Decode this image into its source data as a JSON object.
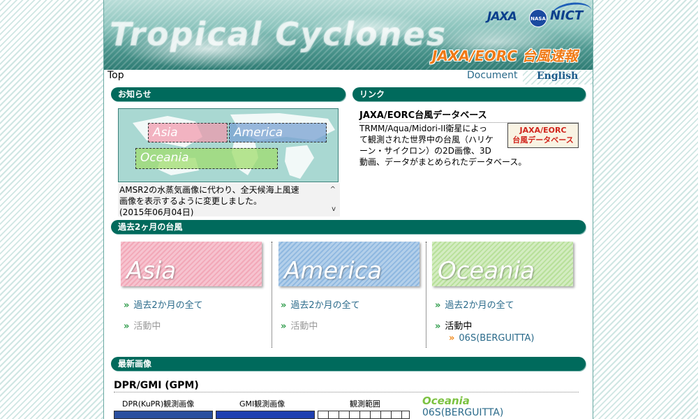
{
  "banner": {
    "title": "Tropical Cyclones",
    "subtitle": "JAXA/EORC 台風速報",
    "logos": {
      "jaxa": "JAXA",
      "nasa": "NASA",
      "nict": "NICT"
    }
  },
  "nav": {
    "top": "Top",
    "document": "Document",
    "english": "English"
  },
  "news": {
    "header": "お知らせ",
    "map_regions": {
      "asia": "Asia",
      "america": "America",
      "oceania": "Oceania"
    },
    "text_line1": "AMSR2の水蒸気画像に代わり、全天候海上風速",
    "text_line2": "画像を表示するように変更しました。",
    "text_line3": "(2015年06月04日)",
    "scroll_up": "^",
    "scroll_down": "v"
  },
  "links": {
    "header": "リンク",
    "title": "JAXA/EORC台風データベース",
    "description": "TRMM/Aqua/Midori-II衛星によって観測された世界中の台風（ハリケーン・サイクロン）の2D画像、3D動画、データがまとめられたデータベース。",
    "badge_line1": "JAXA/EORC",
    "badge_line2": "台風データベース"
  },
  "recent": {
    "header": "過去2ヶ月の台風",
    "regions": [
      {
        "name": "Asia",
        "all_link": "過去2か月の全て",
        "active_label": "活動中"
      },
      {
        "name": "America",
        "all_link": "過去2か月の全て",
        "active_label": "活動中"
      },
      {
        "name": "Oceania",
        "all_link": "過去2か月の全て",
        "active_label": "活動中",
        "active_storm": "06S(BERGUITTA)"
      }
    ]
  },
  "latest": {
    "header": "最新画像",
    "sensor": "DPR/GMI (GPM)",
    "col_dpr": "DPR(KuPR)観測画像",
    "col_gmi": "GMI観測画像",
    "col_range": "観測範囲",
    "region": "Oceania",
    "storm": "06S(BERGUITTA)"
  },
  "colors": {
    "header_bar": "#006a5c",
    "asia": "#f2a8b8",
    "america": "#8fb8e0",
    "oceania": "#b8e09a",
    "link": "#2a6a8a"
  }
}
